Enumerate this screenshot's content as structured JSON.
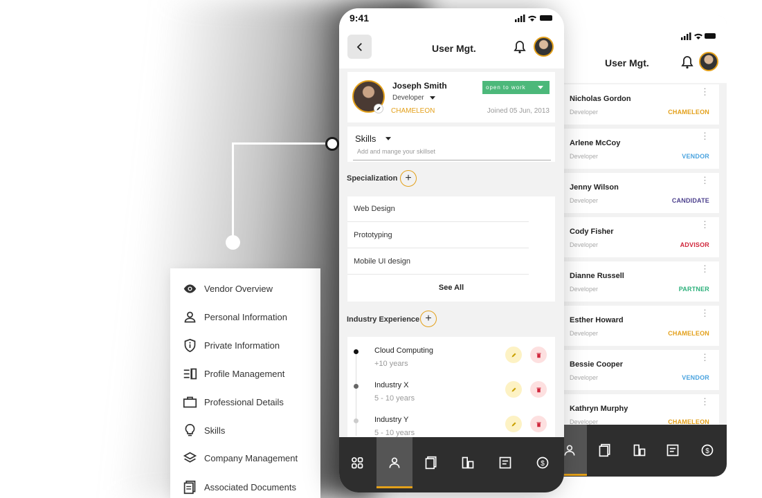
{
  "main_phone": {
    "status_time": "9:41",
    "title": "User Mgt.",
    "profile": {
      "name": "Joseph Smith",
      "role": "Developer",
      "company": "CHAMELEON",
      "status_button": "open to work",
      "joined": "Joined 05 Jun, 2013"
    },
    "skills": {
      "label": "Skills",
      "placeholder": "Add and mange your skillset"
    },
    "specialization": {
      "label": "Specialization",
      "items": [
        "Web Design",
        "Prototyping",
        "Mobile UI design"
      ],
      "see_all": "See All"
    },
    "industry_experience": {
      "label": "Industry Experience",
      "items": [
        {
          "name": "Cloud Computing",
          "years": "+10 years"
        },
        {
          "name": "Industry X",
          "years": "5 - 10 years"
        },
        {
          "name": "Industry Y",
          "years": "5 - 10 years"
        }
      ]
    },
    "tabs": [
      "dashboard-icon",
      "user-icon",
      "documents-icon",
      "buildings-icon",
      "notes-icon",
      "dollar-icon"
    ]
  },
  "back_phone": {
    "title": "User Mgt.",
    "users": [
      {
        "name": "Nicholas Gordon",
        "role": "Developer",
        "badge": "CHAMELEON",
        "color": "#e3a01a"
      },
      {
        "name": "Arlene McCoy",
        "role": "Developer",
        "badge": "VENDOR",
        "color": "#4aa3df"
      },
      {
        "name": "Jenny Wilson",
        "role": "Developer",
        "badge": "CANDIDATE",
        "color": "#4b3f8c"
      },
      {
        "name": "Cody Fisher",
        "role": "Developer",
        "badge": "ADVISOR",
        "color": "#d0273c"
      },
      {
        "name": "Dianne Russell",
        "role": "Developer",
        "badge": "PARTNER",
        "color": "#2bb07a"
      },
      {
        "name": "Esther Howard",
        "role": "Developer",
        "badge": "CHAMELEON",
        "color": "#e3a01a"
      },
      {
        "name": "Bessie Cooper",
        "role": "Developer",
        "badge": "VENDOR",
        "color": "#4aa3df"
      },
      {
        "name": "Kathryn Murphy",
        "role": "Developer",
        "badge": "CHAMELEON",
        "color": "#e3a01a"
      }
    ]
  },
  "side_menu": {
    "items": [
      {
        "label": "Vendor Overview",
        "icon": "eye-icon"
      },
      {
        "label": "Personal Information",
        "icon": "person-icon"
      },
      {
        "label": "Private Information",
        "icon": "shield-icon"
      },
      {
        "label": "Profile Management",
        "icon": "profile-list-icon"
      },
      {
        "label": "Professional Details",
        "icon": "briefcase-icon"
      },
      {
        "label": "Skills",
        "icon": "lightbulb-icon"
      },
      {
        "label": "Company Management",
        "icon": "layers-icon"
      },
      {
        "label": "Associated Documents",
        "icon": "documents-icon"
      }
    ]
  },
  "colors": {
    "accent": "#e3a01a",
    "open_to_work": "#4cb87a",
    "tabbar": "#2e2e2e"
  }
}
